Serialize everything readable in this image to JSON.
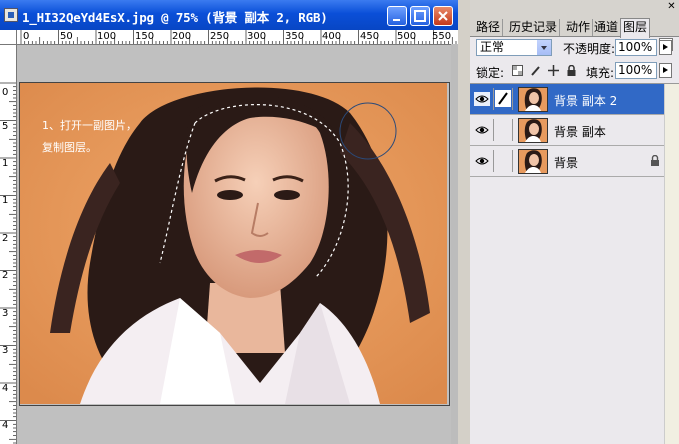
{
  "document": {
    "title": "1_HI32QeYd4EsX.jpg @ 75% (背景 副本 2, RGB)",
    "zoom": "75%",
    "ruler_top_ticks": [
      "0",
      "50",
      "100",
      "150",
      "200",
      "250",
      "300",
      "350",
      "400",
      "450",
      "500",
      "550"
    ],
    "ruler_left_ticks": [
      "0",
      "5",
      "1",
      "1",
      "2",
      "2",
      "3",
      "3",
      "4",
      "4"
    ],
    "photo_text_line1": "1、打开一副图片，",
    "photo_text_line2": "复制图层。"
  },
  "layers_panel": {
    "tabs": [
      "路径",
      "历史记录",
      "动作",
      "通道",
      "图层"
    ],
    "active_tab": "图层",
    "blend_mode": "正常",
    "opacity_label": "不透明度:",
    "opacity_value": "100%",
    "lock_label": "锁定:",
    "fill_label": "填充:",
    "fill_value": "100%",
    "layers": [
      {
        "name": "背景 副本 2",
        "selected": true,
        "visible": true,
        "locked": false
      },
      {
        "name": "背景 副本",
        "selected": false,
        "visible": true,
        "locked": false
      },
      {
        "name": "背景",
        "selected": false,
        "visible": true,
        "locked": true
      }
    ]
  },
  "colors": {
    "titlebar": "#0a4fd8",
    "selection": "#3169c6",
    "photo_background": "#e79a5e"
  }
}
